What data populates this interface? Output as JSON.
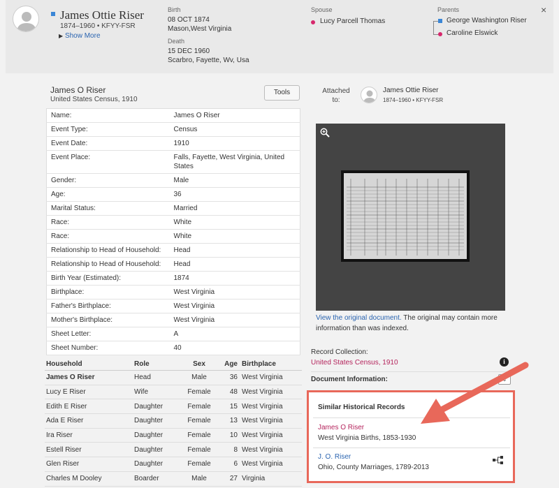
{
  "header": {
    "person": {
      "name": "James Ottie Riser",
      "lifespan": "1874–1960 • KFYY-FSR",
      "show_more": "Show More"
    },
    "birth": {
      "label": "Birth",
      "date": "08 OCT 1874",
      "place": "Mason,West Virginia"
    },
    "death": {
      "label": "Death",
      "date": "15 DEC 1960",
      "place": "Scarbro, Fayette, Wv, Usa"
    },
    "spouse": {
      "label": "Spouse",
      "name": "Lucy Parcell Thomas"
    },
    "parents": {
      "label": "Parents",
      "father": "George Washington Riser",
      "mother": "Caroline Elswick"
    },
    "close": "×"
  },
  "record": {
    "title": "James O Riser",
    "subtitle": "United States Census, 1910",
    "tools_label": "Tools",
    "facts": [
      {
        "k": "Name:",
        "v": "James O Riser"
      },
      {
        "k": "Event Type:",
        "v": "Census"
      },
      {
        "k": "Event Date:",
        "v": "1910"
      },
      {
        "k": "Event Place:",
        "v": "Falls, Fayette, West Virginia, United States"
      },
      {
        "k": "Gender:",
        "v": "Male"
      },
      {
        "k": "Age:",
        "v": "36"
      },
      {
        "k": "Marital Status:",
        "v": "Married"
      },
      {
        "k": "Race:",
        "v": "White"
      },
      {
        "k": "Race:",
        "v": "White"
      },
      {
        "k": "Relationship to Head of Household:",
        "v": "Head"
      },
      {
        "k": "Relationship to Head of Household:",
        "v": "Head"
      },
      {
        "k": "Birth Year (Estimated):",
        "v": "1874"
      },
      {
        "k": "Birthplace:",
        "v": "West Virginia"
      },
      {
        "k": "Father's Birthplace:",
        "v": "West Virginia"
      },
      {
        "k": "Mother's Birthplace:",
        "v": "West Virginia"
      },
      {
        "k": "Sheet Letter:",
        "v": "A"
      },
      {
        "k": "Sheet Number:",
        "v": "40"
      }
    ]
  },
  "household": {
    "headers": [
      "Household",
      "Role",
      "Sex",
      "Age",
      "Birthplace"
    ],
    "rows": [
      {
        "name": "James O Riser",
        "role": "Head",
        "sex": "Male",
        "age": "36",
        "birthplace": "West Virginia",
        "is_link": false
      },
      {
        "name": "Lucy E Riser",
        "role": "Wife",
        "sex": "Female",
        "age": "48",
        "birthplace": "West Virginia",
        "is_link": true
      },
      {
        "name": "Edith E Riser",
        "role": "Daughter",
        "sex": "Female",
        "age": "15",
        "birthplace": "West Virginia",
        "is_link": true
      },
      {
        "name": "Ada E Riser",
        "role": "Daughter",
        "sex": "Female",
        "age": "13",
        "birthplace": "West Virginia",
        "is_link": true
      },
      {
        "name": "Ira Riser",
        "role": "Daughter",
        "sex": "Female",
        "age": "10",
        "birthplace": "West Virginia",
        "is_link": true
      },
      {
        "name": "Estell Riser",
        "role": "Daughter",
        "sex": "Female",
        "age": "8",
        "birthplace": "West Virginia",
        "is_link": true
      },
      {
        "name": "Glen Riser",
        "role": "Daughter",
        "sex": "Female",
        "age": "6",
        "birthplace": "West Virginia",
        "is_link": true
      },
      {
        "name": "Charles M Dooley",
        "role": "Boarder",
        "sex": "Male",
        "age": "27",
        "birthplace": "Virginia",
        "is_link": true
      }
    ]
  },
  "attached": {
    "label": "Attached to:",
    "name": "James Ottie Riser",
    "lifespan": "1874–1960 • KFYY-FSR"
  },
  "viewer": {
    "view_original_link": "View the original document.",
    "view_original_text": " The original may contain more information than was indexed."
  },
  "record_collection": {
    "label": "Record Collection:",
    "value": "United States Census, 1910"
  },
  "document_information": {
    "label": "Document Information:",
    "toggle": "⌄"
  },
  "similar": {
    "title": "Similar Historical Records",
    "items": [
      {
        "name": "James O Riser",
        "sub": "West Virginia Births, 1853-1930"
      },
      {
        "name": "J. O. Riser",
        "sub": "Ohio, County Marriages, 1789-2013"
      }
    ]
  },
  "colors": {
    "accent_blue": "#2a64b0",
    "accent_pink": "#b4245c",
    "highlight_red": "#e8685a"
  }
}
